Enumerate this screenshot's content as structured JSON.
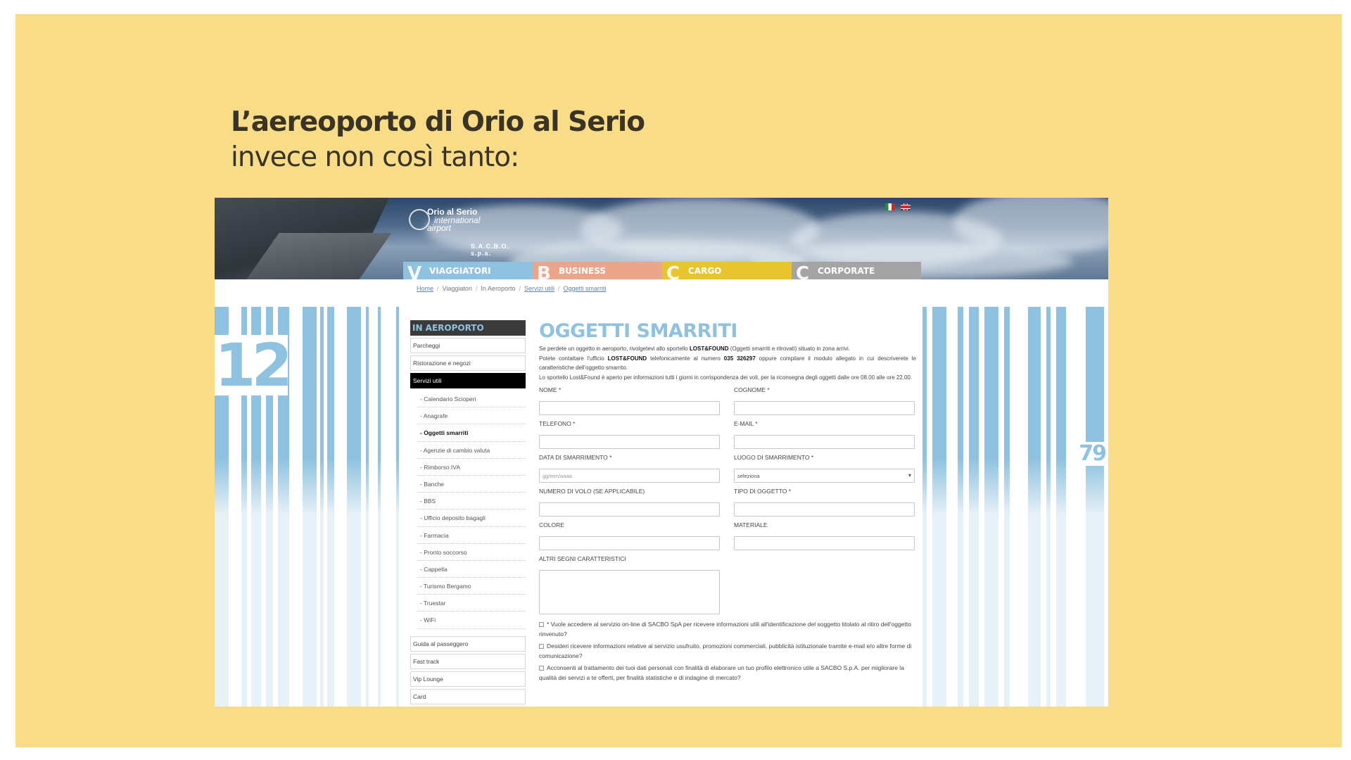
{
  "slide": {
    "title": "L’aereoporto di Orio al Serio",
    "subtitle": "invece non così tanto:"
  },
  "header": {
    "logo": {
      "line1": "Orio al Serio",
      "line2": "international",
      "line3": "airport",
      "line4": "S.A.C.B.O. s.p.a."
    },
    "nav": [
      {
        "letter": "V",
        "label": "VIAGGIATORI",
        "color": "#8fc2e0"
      },
      {
        "letter": "B",
        "label": "BUSINESS",
        "color": "#eaa58a"
      },
      {
        "letter": "C",
        "label": "CARGO",
        "color": "#e8c42f"
      },
      {
        "letter": "C",
        "label": "CORPORATE",
        "color": "#a4a4a4"
      }
    ]
  },
  "breadcrumb": [
    "Home",
    "Viaggiatori",
    "In Aeroporto",
    "Servizi utili",
    "Oggetti smarriti"
  ],
  "decor": {
    "left_number": "12",
    "right_number": "79"
  },
  "sidebar": {
    "title": "IN AEROPORTO",
    "top_items": [
      "Parcheggi",
      "Ristorazione e negozi",
      "Servizi utili"
    ],
    "sub_items": [
      "- Calendario Scioperi",
      "- Anagrafe",
      "- Oggetti smarriti",
      "- Agenzie di cambio valuta",
      "- Rimborso IVA",
      "- Banche",
      "- BBS",
      "- Ufficio deposito bagagli",
      "- Farmacia",
      "- Pronto soccorso",
      "- Cappella",
      "- Turismo Bergamo",
      "- Truestar",
      "- WiFi"
    ],
    "bottom_items": [
      "Guida al passeggero",
      "Fast track",
      "Vip Lounge",
      "Card"
    ]
  },
  "main": {
    "title": "OGGETTI SMARRITI",
    "intro": {
      "p1a": "Se perdete un oggetto in aeroporto, rivolgetevi allo sportello ",
      "p1b": "LOST&FOUND",
      "p1c": " (Oggetti smarriti e ritrovati) situato in zona arrivi.",
      "p2a": "Potete contattare l'ufficio ",
      "p2b": "LOST&FOUND",
      "p2c": " telefonicamente al numero ",
      "p2d": "035 326297",
      "p2e": " oppure compilare il modulo allegato in cui descriverete le caratteristiche dell'oggetto smarrito.",
      "p3": "Lo sportello Lost&Found è aperto per informazioni tutti i giorni in corrispondenza dei voli, per la riconsegna degli oggetti dalle ore 08.00 alle ore 22.00."
    },
    "fields": {
      "nome": "NOME *",
      "cognome": "COGNOME *",
      "telefono": "TELEFONO *",
      "email": "E-MAIL *",
      "data": "DATA DI SMARRIMENTO *",
      "data_placeholder": "gg/mm/aaaa",
      "luogo": "LUOGO DI SMARRIMENTO *",
      "luogo_value": "seleziona",
      "volo": "NUMERO DI VOLO (SE APPLICABILE)",
      "tipo": "TIPO DI OGGETTO *",
      "colore": "COLORE",
      "materiale": "MATERIALE",
      "segni": "ALTRI SEGNI CARATTERISTICI"
    },
    "checks": [
      "* Vuole accedere al servizio on-line di SACBO SpA per ricevere informazioni utili all'identificazione del soggetto titolato al ritiro dell'oggetto rinvenuto?",
      "Desideri ricevere informazioni relative al servizio usufruito, promozioni commerciali, pubblicità istituzionale tramite e-mail e/o altre forme di comunicazione?",
      "Acconsenti al trattamento dei tuoi dati personali con finalità di elaborare un tuo profilo elettronico utile a SACBO S.p.A. per migliorare la qualità dei servizi a te offerti, per finalità statistiche e di indagine di mercato?"
    ]
  }
}
